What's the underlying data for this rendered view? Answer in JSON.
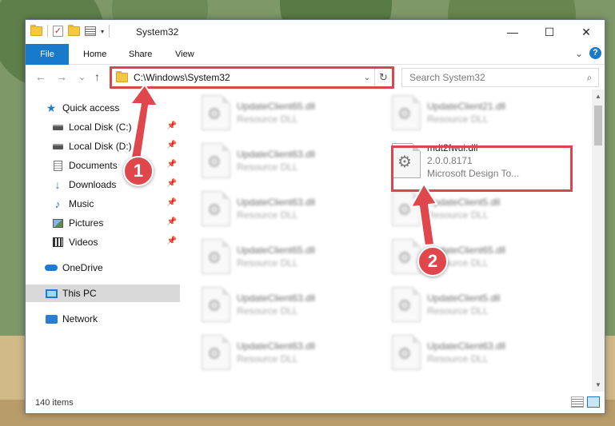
{
  "window": {
    "title": "System32",
    "controls": {
      "minimize": "—",
      "maximize": "☐",
      "close": "✕"
    }
  },
  "ribbon": {
    "tabs": [
      {
        "label": "File"
      },
      {
        "label": "Home"
      },
      {
        "label": "Share"
      },
      {
        "label": "View"
      }
    ],
    "collapse_glyph": "⌄",
    "help_glyph": "?"
  },
  "nav": {
    "back_glyph": "←",
    "forward_glyph": "→",
    "recent_glyph": "⌄",
    "up_glyph": "↑",
    "address": "C:\\Windows\\System32",
    "address_drop_glyph": "⌄",
    "refresh_glyph": "↻",
    "search_placeholder": "Search System32",
    "search_glyph": "⌕"
  },
  "sidebar": {
    "items": [
      {
        "label": "Quick access",
        "icon": "star-icon",
        "pinned": false
      },
      {
        "label": "Local Disk (C:)",
        "icon": "drive-icon",
        "pinned": true
      },
      {
        "label": "Local Disk (D:)",
        "icon": "drive-icon",
        "pinned": true
      },
      {
        "label": "Documents",
        "icon": "document-icon",
        "pinned": true
      },
      {
        "label": "Downloads",
        "icon": "download-icon",
        "pinned": true
      },
      {
        "label": "Music",
        "icon": "music-icon",
        "pinned": true
      },
      {
        "label": "Pictures",
        "icon": "pictures-icon",
        "pinned": true
      },
      {
        "label": "Videos",
        "icon": "videos-icon",
        "pinned": true
      },
      {
        "label": "OneDrive",
        "icon": "onedrive-icon",
        "pinned": false
      },
      {
        "label": "This PC",
        "icon": "this-pc-icon",
        "pinned": false,
        "selected": true
      },
      {
        "label": "Network",
        "icon": "network-icon",
        "pinned": false
      }
    ],
    "pin_glyph": "📌"
  },
  "files": [
    {
      "name": "UpdateClient65.dll",
      "sub": "Resource DLL",
      "blurred": true
    },
    {
      "name": "UpdateClient21.dll",
      "sub": "Resource DLL",
      "blurred": true
    },
    {
      "name": "UpdateClient63.dll",
      "sub": "Resource DLL",
      "blurred": true
    },
    {
      "name": "mdt2fwui.dll",
      "version": "2.0.0.8171",
      "sub": "Microsoft Design To...",
      "blurred": false,
      "highlighted": true
    },
    {
      "name": "UpdateClient63.dll",
      "sub": "Resource DLL",
      "blurred": true
    },
    {
      "name": "UpdateClient5.dll",
      "sub": "Resource DLL",
      "blurred": true
    },
    {
      "name": "UpdateClient65.dll",
      "sub": "Resource DLL",
      "blurred": true
    },
    {
      "name": "UpdateClient65.dll",
      "sub": "Resource DLL",
      "blurred": true
    },
    {
      "name": "UpdateClient63.dll",
      "sub": "Resource DLL",
      "blurred": true
    },
    {
      "name": "UpdateClient5.dll",
      "sub": "Resource DLL",
      "blurred": true
    },
    {
      "name": "UpdateClient63.dll",
      "sub": "Resource DLL",
      "blurred": true
    },
    {
      "name": "UpdateClient63.dll",
      "sub": "Resource DLL",
      "blurred": true
    }
  ],
  "status": {
    "item_count": "140 items"
  },
  "annotations": [
    {
      "number": "1",
      "target": "address-bar"
    },
    {
      "number": "2",
      "target": "mdt2fwui-file"
    }
  ],
  "colors": {
    "accent": "#1979ca",
    "highlight_red": "#d8474c"
  }
}
